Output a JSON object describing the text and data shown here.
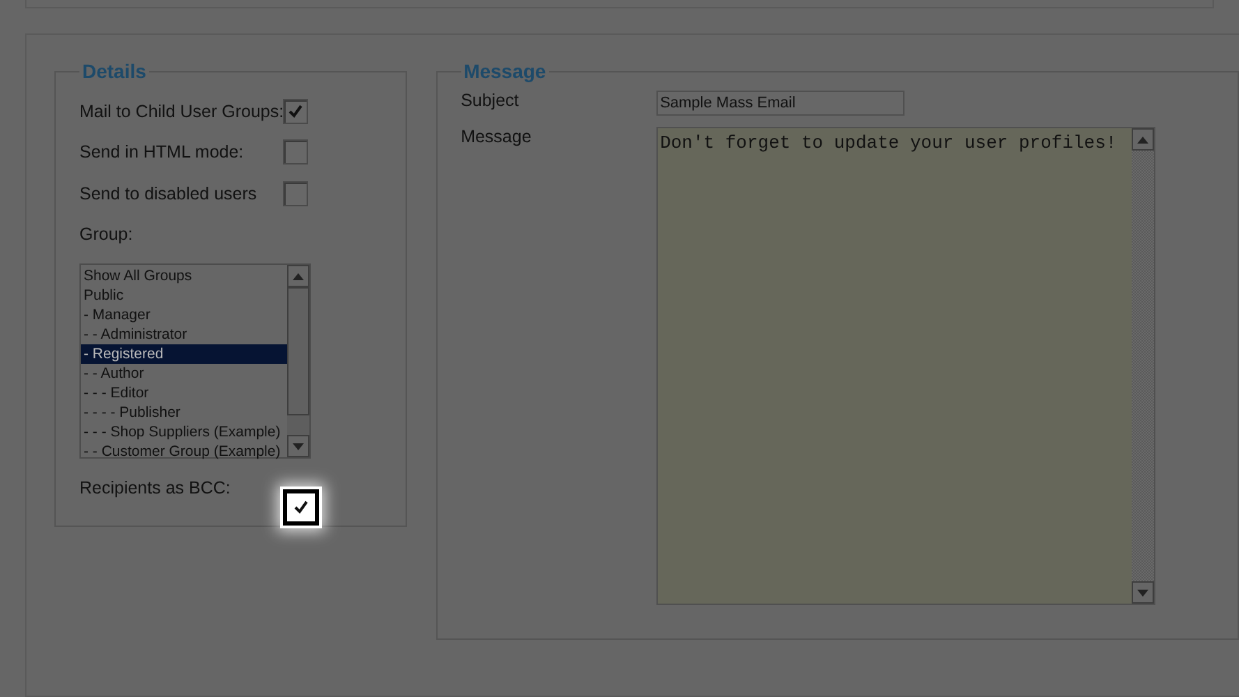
{
  "details": {
    "legend": "Details",
    "options": [
      {
        "label": "Mail to Child User Groups:",
        "checked": true
      },
      {
        "label": "Send in HTML mode:",
        "checked": false
      },
      {
        "label": "Send to disabled users",
        "checked": false
      }
    ],
    "group_label": "Group:",
    "groups": [
      {
        "label": "Show All Groups",
        "selected": false
      },
      {
        "label": "Public",
        "selected": false
      },
      {
        "label": "- Manager",
        "selected": false
      },
      {
        "label": "- - Administrator",
        "selected": false
      },
      {
        "label": "- Registered",
        "selected": true
      },
      {
        "label": "- - Author",
        "selected": false
      },
      {
        "label": "- - - Editor",
        "selected": false
      },
      {
        "label": "- - - - Publisher",
        "selected": false
      },
      {
        "label": "- - - Shop Suppliers (Example)",
        "selected": false
      },
      {
        "label": "- - Customer Group (Example)",
        "selected": false
      }
    ],
    "bcc": {
      "label": "Recipients as BCC:",
      "checked": true,
      "highlighted": true
    }
  },
  "message": {
    "legend": "Message",
    "subject_label": "Subject",
    "subject": "Sample Mass Email",
    "message_label": "Message",
    "message": "Don't forget to update your user profiles!"
  }
}
